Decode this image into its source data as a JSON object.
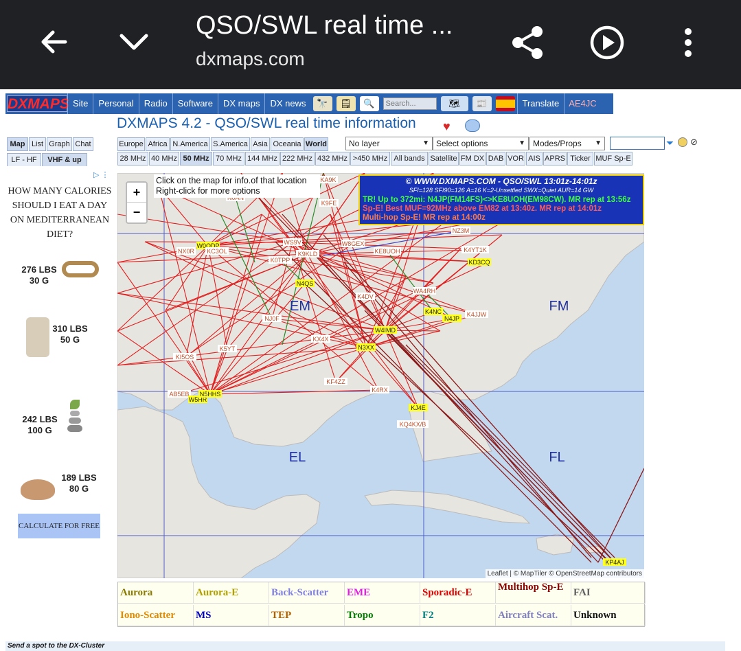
{
  "browser": {
    "title": "QSO/SWL real time ...",
    "url": "dxmaps.com",
    "icons": [
      "back-arrow-icon",
      "chevron-down-icon",
      "share-icon",
      "play-icon",
      "more-vert-icon"
    ]
  },
  "topnav": {
    "logo": "DXMAPS",
    "items": [
      "Site",
      "Personal",
      "Radio",
      "Software",
      "DX maps",
      "DX news"
    ],
    "search_placeholder": "Search...",
    "translate": "Translate",
    "user": "AE4JC"
  },
  "page_title": "DXMAPS 4.2 - QSO/SWL real time information",
  "view_tabs": [
    "Map",
    "List",
    "Graph",
    "Chat"
  ],
  "band_group_tabs": [
    "LF - HF",
    "VHF & up"
  ],
  "region_tabs": [
    "Europe",
    "Africa",
    "N.America",
    "S.America",
    "Asia",
    "Oceania",
    "World"
  ],
  "selects": {
    "layer": "No layer",
    "options": "Select options",
    "modes": "Modes/Props"
  },
  "band_tabs": [
    "28 MHz",
    "40 MHz",
    "50 MHz",
    "70 MHz",
    "144 MHz",
    "222 MHz",
    "432 MHz",
    ">450 MHz",
    "All bands",
    "Satellite",
    "FM DX",
    "DAB",
    "VOR",
    "AIS",
    "APRS",
    "Ticker",
    "MUF Sp-E"
  ],
  "ad": {
    "headline": "HOW MANY CALORIES SHOULD I EAT A DAY ON MEDITERRANEAN DIET?",
    "items": [
      {
        "lbs": "276 LBS",
        "kg": "30 G"
      },
      {
        "lbs": "310 LBS",
        "kg": "50 G"
      },
      {
        "lbs": "242 LBS",
        "kg": "100 G"
      },
      {
        "lbs": "189 LBS",
        "kg": "80 G"
      }
    ],
    "button": "CALCULATE FOR FREE"
  },
  "map": {
    "tooltip_line1": "Click on the map for info.of that location",
    "tooltip_line2": "Right-click for more options",
    "zoom_in": "+",
    "zoom_out": "−",
    "grid_squares": [
      "EM",
      "FM",
      "EL",
      "FL"
    ],
    "info": {
      "header": "© WWW.DXMAPS.COM - QSO/SWL 13:01z-14:01z",
      "solar": "SFI=128 SFI90=126 A=16 K=2-Unsettled SWX=Quiet AUR=14 GW",
      "line1": "TR! Up to 372mi: N4JP(FM14FS)<>KE8UOH(EM98CW). MR rep at 13:56z",
      "line2": "Sp-E! Best MUF=92MHz above EM82 at 13:40z. MR rep at 14:01z",
      "line3": "Multi-hop Sp-E! MR rep at 14:00z"
    },
    "attribution": "Leaflet | © MapTiler © OpenStreetMap contributors",
    "stations": [
      "KA9K",
      "K9FE",
      "N0AN",
      "W0QDP",
      "NX0R",
      "KC3OL",
      "WS9V",
      "K9KLD",
      "K0TPP",
      "W8GEX",
      "KE8UOH",
      "K4YT1K",
      "KD3CQ",
      "NZ3M",
      "N4QS",
      "K4DV",
      "WA4RH",
      "K4NC",
      "N4JP",
      "K4JJW",
      "NJ0F",
      "W4IMD",
      "KX4X",
      "N3XX",
      "K5YT",
      "KI5OS",
      "KF4ZZ",
      "AB5EB",
      "W5HR",
      "N5HHS",
      "K4RX",
      "KJ4E",
      "KQ4KX/B",
      "KP4AJ"
    ]
  },
  "legend": {
    "row1": [
      "Aurora",
      "Aurora-E",
      "Back-Scatter",
      "EME",
      "Sporadic-E",
      "Multihop Sp-E",
      "FAI"
    ],
    "row2": [
      "Iono-Scatter",
      "MS",
      "TEP",
      "Tropo",
      "F2",
      "Aircraft Scat.",
      "Unknown"
    ]
  },
  "spot_bar": "Send a spot to the DX-Cluster",
  "colors": {
    "nav_blue": "#2b63b0",
    "chrome_bg": "#202124",
    "sporadic_e": "#e02020",
    "multihop": "#8b1a1a",
    "tropo": "#2a8a2a",
    "info_bg": "#1833b5"
  }
}
